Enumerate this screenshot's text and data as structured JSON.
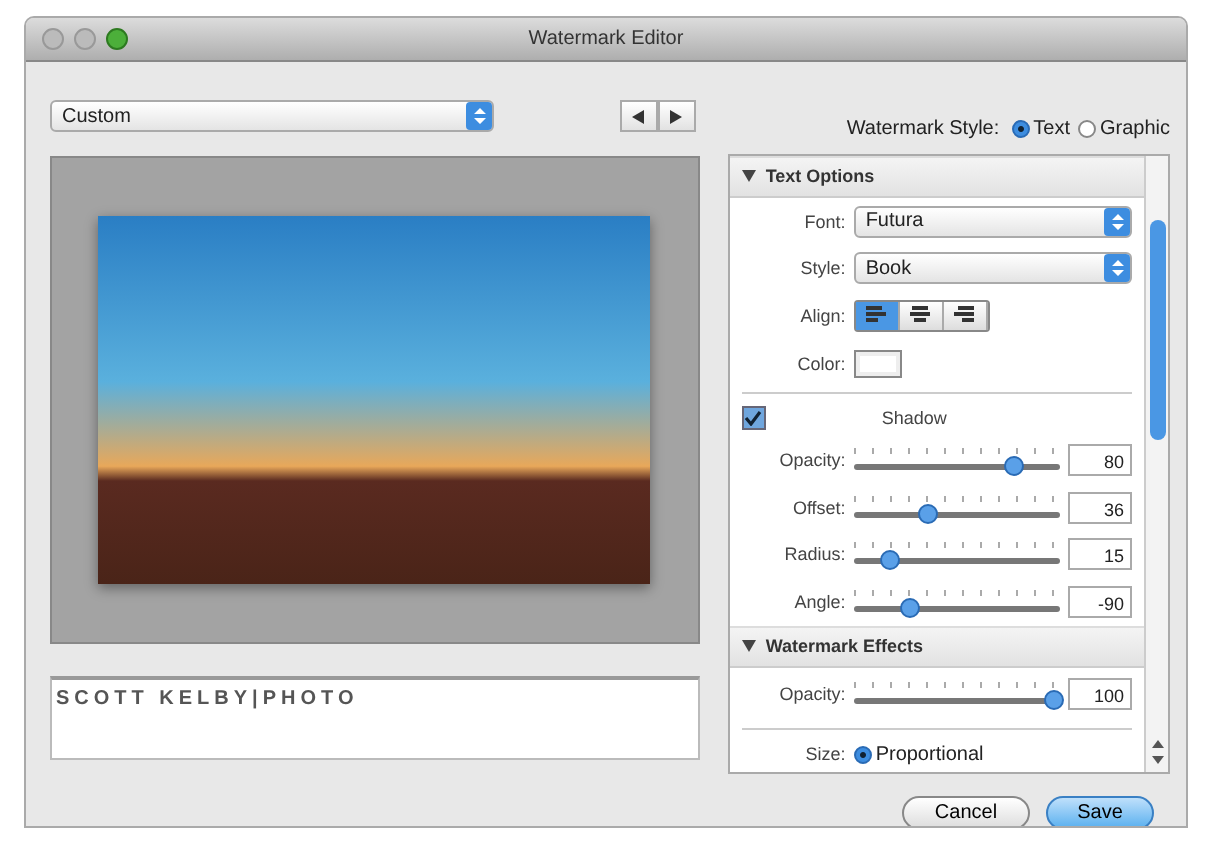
{
  "window": {
    "title": "Watermark Editor"
  },
  "preset": {
    "value": "Custom"
  },
  "watermark_style": {
    "label": "Watermark Style:",
    "options": [
      {
        "label": "Text",
        "selected": true
      },
      {
        "label": "Graphic",
        "selected": false
      }
    ]
  },
  "text_options": {
    "title": "Text Options",
    "expanded": true,
    "font": {
      "label": "Font:",
      "value": "Futura"
    },
    "style": {
      "label": "Style:",
      "value": "Book"
    },
    "align": {
      "label": "Align:",
      "options": [
        {
          "kind": "left",
          "selected": true
        },
        {
          "kind": "center",
          "selected": false
        },
        {
          "kind": "right",
          "selected": false
        }
      ]
    },
    "color": {
      "label": "Color:"
    },
    "shadow": {
      "label": "Shadow",
      "checked": true
    },
    "sliders": [
      {
        "label": "Opacity:",
        "level": 0.78,
        "value": "80"
      },
      {
        "label": "Offset:",
        "level": 0.36,
        "value": "36"
      },
      {
        "label": "Radius:",
        "level": 0.18,
        "value": "15"
      },
      {
        "label": "Angle:",
        "level": 0.27,
        "value": "-90"
      }
    ]
  },
  "watermark_effects": {
    "title": "Watermark Effects",
    "expanded": true,
    "opacity": {
      "label": "Opacity:",
      "level": 0.97,
      "value": "100"
    },
    "size": {
      "label": "Size:",
      "option": "Proportional",
      "selected": true
    }
  },
  "watermark_text": "SCOTT KELBY|PHOTO",
  "buttons": [
    {
      "label": "Cancel",
      "default": false
    },
    {
      "label": "Save",
      "default": true
    }
  ]
}
